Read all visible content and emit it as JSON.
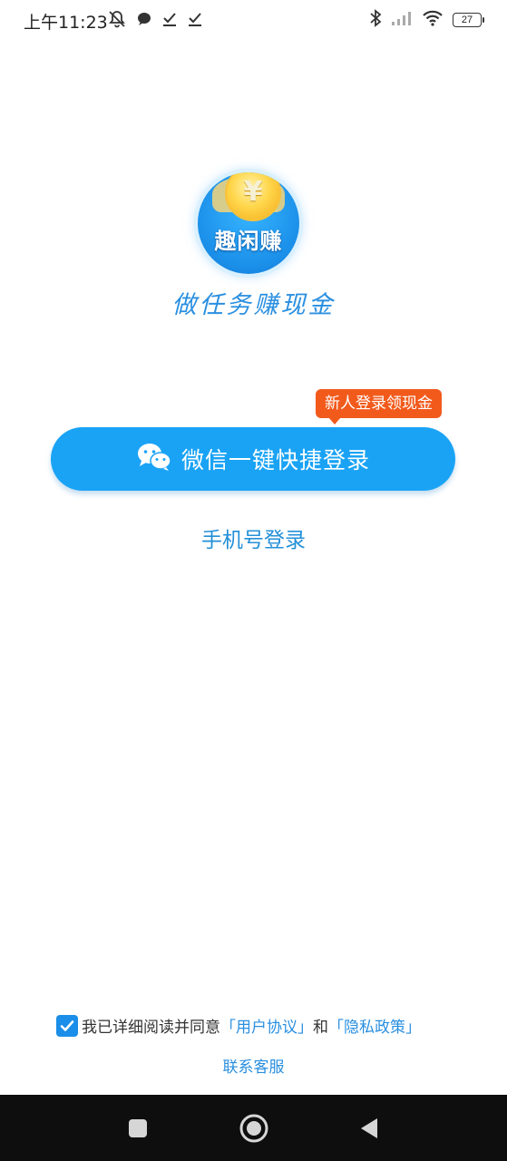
{
  "status_bar": {
    "time": "上午11:23",
    "battery": "27",
    "left_icons": [
      "mute-bell-icon",
      "chat-bubble-icon",
      "check-icon",
      "check-icon"
    ],
    "right_icons": [
      "bluetooth-icon",
      "signal-icon",
      "wifi-icon",
      "battery-icon"
    ]
  },
  "logo": {
    "symbol": "¥",
    "text": "趣闲赚"
  },
  "slogan": "做任务赚现金",
  "badge": "新人登录领现金",
  "wechat_login": {
    "label": "微信一键快捷登录",
    "icon": "wechat-icon"
  },
  "phone_login": "手机号登录",
  "agreement": {
    "checked": true,
    "prefix": "我已详细阅读并同意",
    "user_agreement": "「用户协议」",
    "conjunction": "和",
    "privacy_policy": "「隐私政策」"
  },
  "contact": "联系客服",
  "colors": {
    "primary": "#1aa3f5",
    "link": "#2a8fe0",
    "badge": "#f25a1c",
    "nav_bar": "#0e0e0e"
  },
  "nav_bar": {
    "buttons": [
      "recent-apps-icon",
      "home-icon",
      "back-icon"
    ]
  }
}
